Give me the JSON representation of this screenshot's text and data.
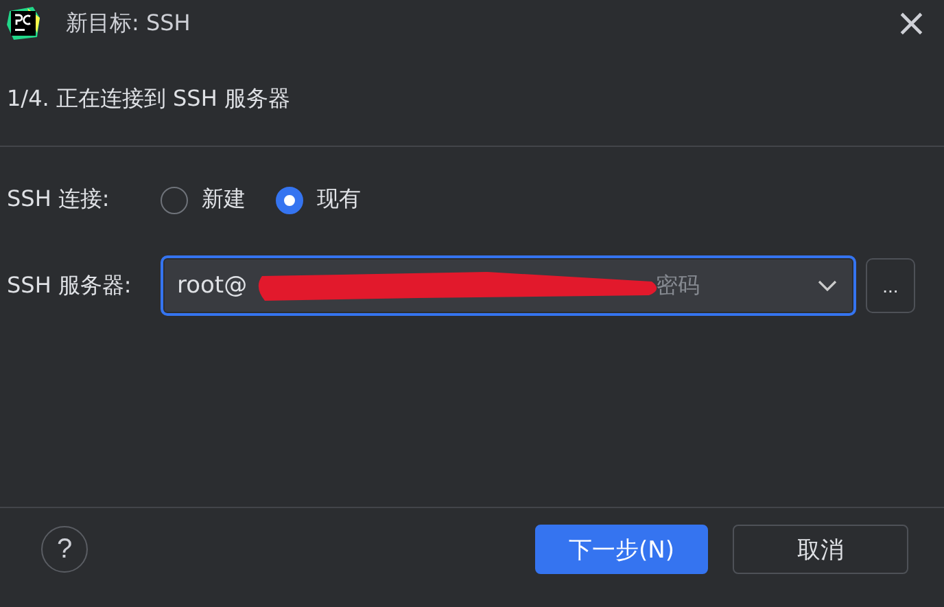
{
  "window": {
    "title": "新目标: SSH",
    "close": "×"
  },
  "step": "1/4. 正在连接到 SSH 服务器",
  "connection": {
    "label": "SSH 连接:",
    "options": [
      {
        "label": "新建",
        "selected": false
      },
      {
        "label": "现有",
        "selected": true
      }
    ]
  },
  "server": {
    "label": "SSH 服务器:",
    "value": "root@",
    "auth": "密码",
    "redacted": true,
    "browse": "..."
  },
  "help": "?",
  "buttons": [
    {
      "label": "下一步(N)",
      "kind": "primary"
    },
    {
      "label": "取消",
      "kind": "secondary"
    }
  ]
}
